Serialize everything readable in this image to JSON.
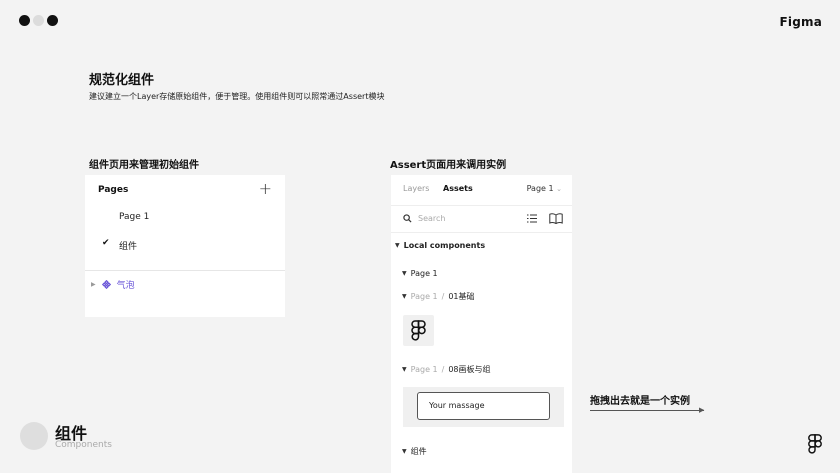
{
  "header": {
    "brand": "Figma",
    "window_dots": [
      "#111111",
      "#dcdcdc",
      "#111111"
    ]
  },
  "heading": {
    "title": "规范化组件",
    "subtitle": "建议建立一个Layer存储原始组件，便于管理。使用组件则可以照常通过Assert模块"
  },
  "left": {
    "section_label": "组件页用来管理初始组件",
    "pages_title": "Pages",
    "pages": [
      {
        "label": "Page 1",
        "selected": false
      },
      {
        "label": "组件",
        "selected": true
      }
    ],
    "layer_item": "气泡"
  },
  "right": {
    "section_label": "Assert页面用来调用实例",
    "tabs": {
      "layers": "Layers",
      "assets": "Assets"
    },
    "page_select": "Page 1",
    "search_placeholder": "Search",
    "local_components": "Local components",
    "tree": {
      "page1": "Page 1",
      "group1_parent": "Page 1",
      "group1_separator": "/",
      "group1_name": "01基础",
      "group2_parent": "Page 1",
      "group2_separator": "/",
      "group2_name": "08画板与组",
      "group3": "组件"
    },
    "preview_input_text": "Your massage"
  },
  "annotation": {
    "drag_note": "拖拽出去就是一个实例"
  },
  "footer": {
    "title": "组件",
    "subtitle": "Components"
  },
  "colors": {
    "accent_purple": "#6a56d8",
    "background": "#f3f3f3"
  }
}
